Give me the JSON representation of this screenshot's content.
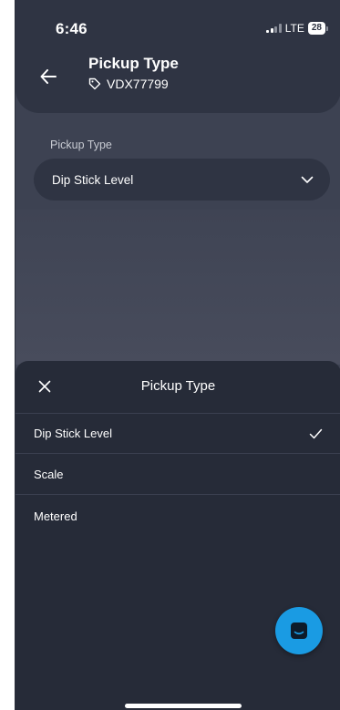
{
  "status_bar": {
    "time": "6:46",
    "network": "LTE",
    "battery": "28"
  },
  "header": {
    "title": "Pickup Type",
    "tag_id": "VDX77799",
    "back_icon": "arrow-left-icon",
    "tag_icon": "tag-icon"
  },
  "form": {
    "pickup_type_label": "Pickup Type",
    "pickup_type_value": "Dip Stick Level"
  },
  "sheet": {
    "title": "Pickup Type",
    "close_icon": "close-icon",
    "options": [
      {
        "label": "Dip Stick Level",
        "selected": true
      },
      {
        "label": "Scale",
        "selected": false
      },
      {
        "label": "Metered",
        "selected": false
      }
    ]
  },
  "fab": {
    "icon": "chat-icon"
  },
  "colors": {
    "background": "#3d4252",
    "header": "#2f3443",
    "sheet": "#262b38",
    "accent": "#1a9be3"
  }
}
